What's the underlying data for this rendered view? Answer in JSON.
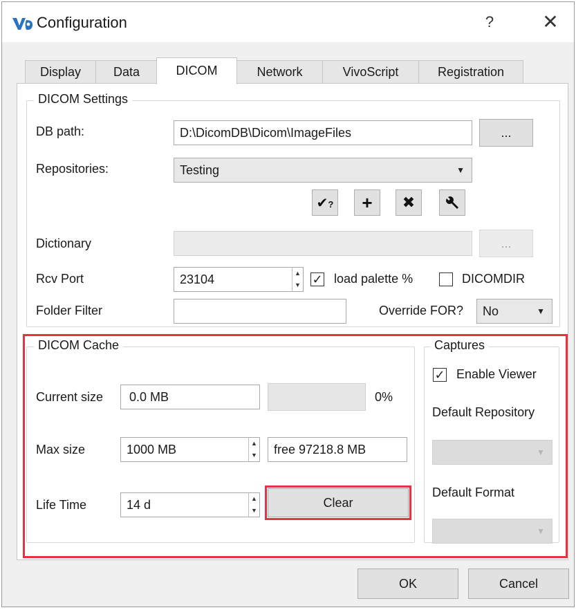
{
  "window": {
    "title": "Configuration",
    "help": "?",
    "close": "✕"
  },
  "tabs": [
    "Display",
    "Data",
    "DICOM",
    "Network",
    "VivoScript",
    "Registration"
  ],
  "active_tab": "DICOM",
  "dicom_settings": {
    "title": "DICOM Settings",
    "db_path_label": "DB path:",
    "db_path_value": "D:\\DicomDB\\Dicom\\ImageFiles",
    "browse": "...",
    "repositories_label": "Repositories:",
    "repositories_value": "Testing",
    "dictionary_label": "Dictionary",
    "dictionary_value": "",
    "dictionary_browse": "...",
    "rcv_port_label": "Rcv Port",
    "rcv_port_value": "23104",
    "load_palette_label": "load palette %",
    "load_palette_checked": true,
    "dicomdir_label": "DICOMDIR",
    "dicomdir_checked": false,
    "folder_filter_label": "Folder Filter",
    "folder_filter_value": "",
    "override_for_label": "Override FOR?",
    "override_for_value": "No"
  },
  "dicom_cache": {
    "title": "DICOM Cache",
    "current_size_label": "Current size",
    "current_size_value": "0.0 MB",
    "usage_percent": "0%",
    "usage_fraction": 0,
    "max_size_label": "Max size",
    "max_size_value": "1000 MB",
    "free_value": "free 97218.8 MB",
    "life_time_label": "Life Time",
    "life_time_value": "14 d",
    "clear_button": "Clear"
  },
  "captures": {
    "title": "Captures",
    "enable_viewer_label": "Enable Viewer",
    "enable_viewer_checked": true,
    "default_repository_label": "Default Repository",
    "default_format_label": "Default Format"
  },
  "footer": {
    "ok": "OK",
    "cancel": "Cancel"
  },
  "colors": {
    "highlight": "#e8323f",
    "tab_active": "#ffffff",
    "dialog_bg": "#f0f0f0"
  }
}
